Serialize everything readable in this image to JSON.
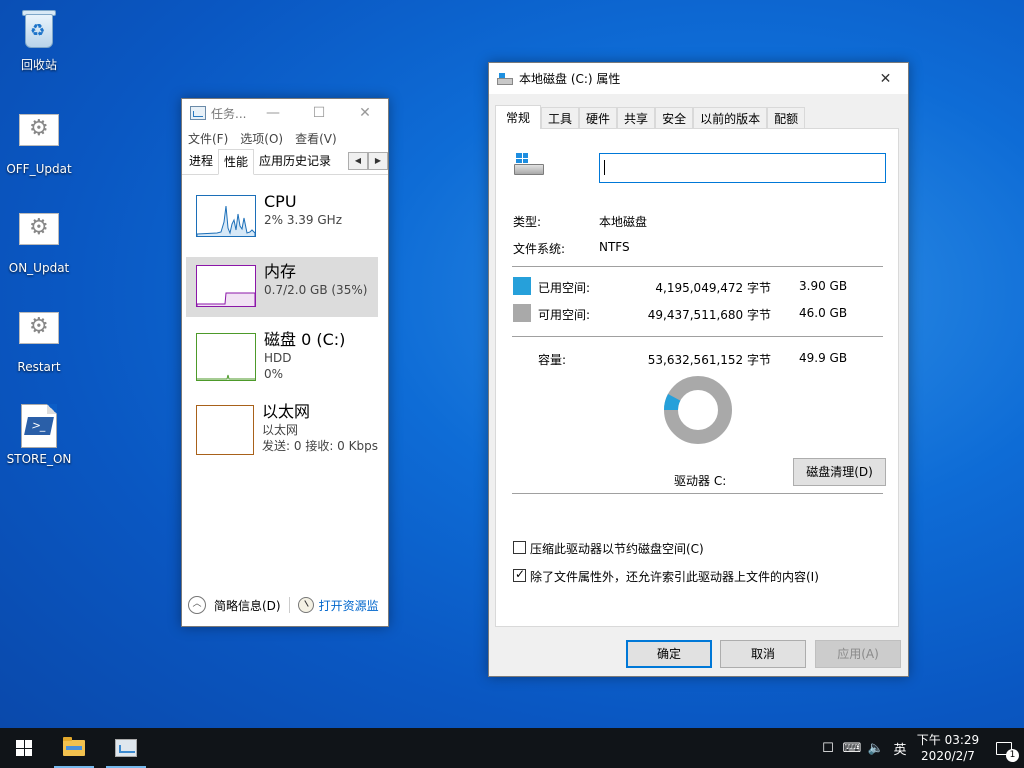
{
  "desktop": {
    "icons": [
      {
        "label": "回收站"
      },
      {
        "label": "OFF_Updat"
      },
      {
        "label": "ON_Updat"
      },
      {
        "label": "Restart"
      },
      {
        "label": "STORE_ON"
      }
    ]
  },
  "taskmgr": {
    "title": "任务...",
    "menu": [
      "文件(F)",
      "选项(O)",
      "查看(V)"
    ],
    "tabs": [
      "进程",
      "性能",
      "应用历史记录"
    ],
    "items": [
      {
        "title": "CPU",
        "sub1": "2% 3.39 GHz",
        "color": "#1c6fb8"
      },
      {
        "title": "内存",
        "sub1": "0.7/2.0 GB (35%)",
        "color": "#8b16a8"
      },
      {
        "title": "磁盘 0 (C:)",
        "sub1": "HDD",
        "sub2": "0%",
        "color": "#4d9a2a"
      },
      {
        "title": "以太网",
        "sub1": "以太网",
        "sub2": "发送: 0 接收: 0 Kbps",
        "color": "#a8611a"
      }
    ],
    "footer": {
      "summary": "简略信息(D)",
      "resmon": "打开资源监"
    }
  },
  "props": {
    "title": "本地磁盘 (C:) 属性",
    "tabs": [
      "常规",
      "工具",
      "硬件",
      "共享",
      "安全",
      "以前的版本",
      "配额"
    ],
    "name_value": "",
    "type_label": "类型:",
    "type_value": "本地磁盘",
    "fs_label": "文件系统:",
    "fs_value": "NTFS",
    "used_label": "已用空间:",
    "used_bytes": "4,195,049,472 字节",
    "used_gb": "3.90 GB",
    "free_label": "可用空间:",
    "free_bytes": "49,437,511,680 字节",
    "free_gb": "46.0 GB",
    "cap_label": "容量:",
    "cap_bytes": "53,632,561,152 字节",
    "cap_gb": "49.9 GB",
    "used_fraction": 0.078,
    "used_color": "#26a0da",
    "free_color": "#a9a9a9",
    "drive_label": "驱动器 C:",
    "cleanup": "磁盘清理(D)",
    "compress": "压缩此驱动器以节约磁盘空间(C)",
    "index": "除了文件属性外，还允许索引此驱动器上文件的内容(I)",
    "ok": "确定",
    "cancel": "取消",
    "apply": "应用(A)"
  },
  "taskbar": {
    "lang": "英",
    "time": "下午 03:29",
    "date": "2020/2/7",
    "notifications": "1"
  }
}
